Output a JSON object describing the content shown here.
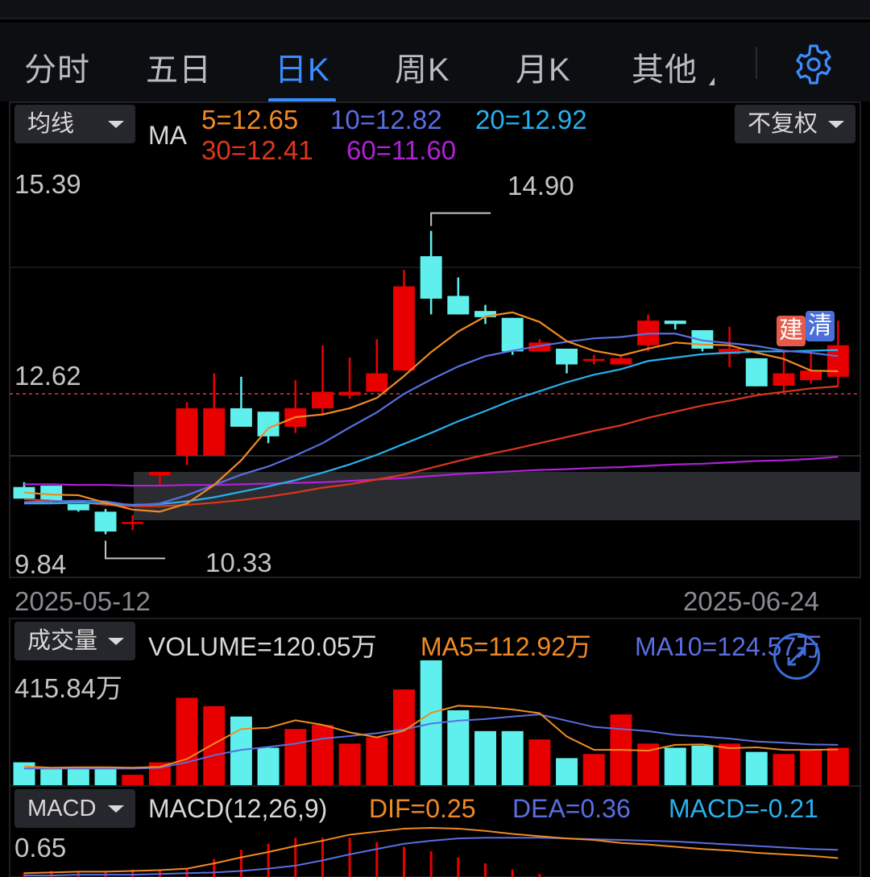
{
  "tabs": [
    {
      "label": "分时",
      "active": false
    },
    {
      "label": "五日",
      "active": false
    },
    {
      "label": "日K",
      "active": true
    },
    {
      "label": "周K",
      "active": false
    },
    {
      "label": "月K",
      "active": false
    },
    {
      "label": "其他",
      "active": false
    }
  ],
  "settings_icon": "gear-icon",
  "main_chart": {
    "indicator_dropdown": "均线",
    "indicator_name": "MA",
    "ma_values": {
      "ma5": "5=12.65",
      "ma10": "10=12.82",
      "ma20": "20=12.92",
      "ma30": "30=12.41",
      "ma60": "60=11.60"
    },
    "adjust_dropdown": "不复权",
    "y_top": "15.39",
    "y_mid": "12.62",
    "y_bottom": "9.84",
    "high_label": "14.90",
    "low_label": "10.33",
    "date_start": "2025-05-12",
    "date_end": "2025-06-24",
    "badge_build": "建",
    "badge_clear": "清"
  },
  "volume_chart": {
    "dropdown": "成交量",
    "volume": "VOLUME=120.05万",
    "ma5": "MA5=112.92万",
    "ma10": "MA10=124.57万",
    "max_label": "415.84万"
  },
  "macd_chart": {
    "dropdown": "MACD",
    "params": "MACD(12,26,9)",
    "dif": "DIF=0.25",
    "dea": "DEA=0.36",
    "macd": "MACD=-0.21",
    "max_label": "0.65"
  },
  "colors": {
    "up": "#e80000",
    "down": "#5ff0ee",
    "ma5": "#f08a24",
    "ma10": "#5a6ee0",
    "ma20": "#27b0ee",
    "ma30": "#e0351e",
    "ma60": "#b021d8",
    "accent": "#3a8dff"
  },
  "chart_data": {
    "type": "candlestick",
    "y_axis_range": [
      9.84,
      15.39
    ],
    "period": [
      "2025-05-12",
      "2025-06-24"
    ],
    "candles": [
      {
        "o": 10.96,
        "c": 10.79,
        "h": 11.03,
        "l": 10.79
      },
      {
        "o": 10.98,
        "c": 10.74,
        "h": 10.98,
        "l": 10.71
      },
      {
        "o": 10.71,
        "c": 10.62,
        "h": 10.71,
        "l": 10.6
      },
      {
        "o": 10.6,
        "c": 10.31,
        "h": 10.64,
        "l": 10.27
      },
      {
        "o": 10.43,
        "c": 10.45,
        "h": 10.55,
        "l": 10.33
      },
      {
        "o": 11.13,
        "c": 11.18,
        "h": 11.18,
        "l": 10.99
      },
      {
        "o": 11.42,
        "c": 12.11,
        "h": 12.2,
        "l": 11.28
      },
      {
        "o": 11.42,
        "c": 12.11,
        "h": 12.62,
        "l": 11.42
      },
      {
        "o": 12.11,
        "c": 11.84,
        "h": 12.57,
        "l": 11.84
      },
      {
        "o": 12.06,
        "c": 11.7,
        "h": 12.06,
        "l": 11.6
      },
      {
        "o": 11.84,
        "c": 12.11,
        "h": 12.52,
        "l": 11.75
      },
      {
        "o": 12.11,
        "c": 12.35,
        "h": 13.03,
        "l": 12.02
      },
      {
        "o": 12.3,
        "c": 12.35,
        "h": 12.85,
        "l": 12.25
      },
      {
        "o": 12.35,
        "c": 12.62,
        "h": 13.12,
        "l": 12.35
      },
      {
        "o": 12.66,
        "c": 13.89,
        "h": 14.13,
        "l": 12.66
      },
      {
        "o": 14.33,
        "c": 13.71,
        "h": 14.7,
        "l": 13.48
      },
      {
        "o": 13.75,
        "c": 13.48,
        "h": 14.02,
        "l": 13.48
      },
      {
        "o": 13.53,
        "c": 13.44,
        "h": 13.62,
        "l": 13.34
      },
      {
        "o": 13.43,
        "c": 12.94,
        "h": 13.43,
        "l": 12.89
      },
      {
        "o": 12.94,
        "c": 13.07,
        "h": 13.12,
        "l": 12.98
      },
      {
        "o": 12.98,
        "c": 12.75,
        "h": 12.98,
        "l": 12.62
      },
      {
        "o": 12.83,
        "c": 12.83,
        "h": 12.89,
        "l": 12.75
      },
      {
        "o": 12.75,
        "c": 12.84,
        "h": 12.89,
        "l": 12.75
      },
      {
        "o": 13.03,
        "c": 13.39,
        "h": 13.48,
        "l": 12.94
      },
      {
        "o": 13.39,
        "c": 13.34,
        "h": 13.39,
        "l": 13.26
      },
      {
        "o": 13.25,
        "c": 12.98,
        "h": 13.25,
        "l": 12.94
      },
      {
        "o": 12.9,
        "c": 12.98,
        "h": 13.3,
        "l": 12.71
      },
      {
        "o": 12.84,
        "c": 12.43,
        "h": 12.84,
        "l": 12.43
      },
      {
        "o": 12.44,
        "c": 12.62,
        "h": 12.94,
        "l": 12.34
      },
      {
        "o": 12.52,
        "c": 12.66,
        "h": 12.94,
        "l": 12.47
      },
      {
        "o": 12.57,
        "c": 13.03,
        "h": 13.39,
        "l": 12.43
      }
    ],
    "ma5": [
      10.88,
      10.85,
      10.84,
      10.73,
      10.63,
      10.6,
      10.72,
      10.99,
      11.35,
      11.82,
      11.98,
      12.02,
      12.11,
      12.26,
      12.58,
      12.93,
      13.23,
      13.45,
      13.51,
      13.37,
      13.09,
      12.95,
      12.88,
      12.98,
      13.07,
      13.04,
      13.03,
      12.92,
      12.83,
      12.66,
      12.65
    ],
    "ma10": [
      10.74,
      10.75,
      10.76,
      10.75,
      10.69,
      10.72,
      10.84,
      10.99,
      11.14,
      11.26,
      11.42,
      11.6,
      11.83,
      12.05,
      12.32,
      12.53,
      12.72,
      12.87,
      12.95,
      13.02,
      13.08,
      13.13,
      13.15,
      13.2,
      13.2,
      13.1,
      13.06,
      13.02,
      12.95,
      12.92,
      12.87
    ],
    "ma20": [
      10.72,
      10.72,
      10.73,
      10.72,
      10.7,
      10.71,
      10.75,
      10.81,
      10.89,
      10.97,
      11.06,
      11.17,
      11.29,
      11.43,
      11.59,
      11.75,
      11.92,
      12.07,
      12.23,
      12.36,
      12.49,
      12.6,
      12.68,
      12.8,
      12.85,
      12.9,
      12.92,
      12.94,
      12.94,
      12.95,
      12.96
    ],
    "ma30": [
      10.78,
      10.76,
      10.74,
      10.7,
      10.68,
      10.68,
      10.7,
      10.73,
      10.77,
      10.82,
      10.88,
      10.95,
      11.0,
      11.07,
      11.14,
      11.24,
      11.34,
      11.43,
      11.51,
      11.6,
      11.69,
      11.78,
      11.86,
      11.97,
      12.06,
      12.15,
      12.22,
      12.3,
      12.35,
      12.4,
      12.43
    ],
    "ma60": [
      11.0,
      11.0,
      10.99,
      10.99,
      10.98,
      10.98,
      10.99,
      10.99,
      11.0,
      11.01,
      11.02,
      11.03,
      11.05,
      11.07,
      11.09,
      11.12,
      11.15,
      11.17,
      11.19,
      11.21,
      11.22,
      11.24,
      11.25,
      11.27,
      11.29,
      11.3,
      11.32,
      11.34,
      11.35,
      11.37,
      11.4
    ],
    "volume": [
      55,
      40,
      40,
      40,
      25,
      55,
      210,
      190,
      165,
      90,
      135,
      145,
      100,
      115,
      230,
      300,
      180,
      130,
      130,
      110,
      65,
      75,
      170,
      100,
      90,
      95,
      100,
      80,
      75,
      85,
      90
    ],
    "volume_ma5": [
      45,
      42,
      43,
      43,
      42,
      44,
      63,
      100,
      135,
      138,
      156,
      145,
      127,
      115,
      131,
      174,
      191,
      188,
      182,
      173,
      117,
      85,
      85,
      83,
      97,
      98,
      89,
      91,
      85,
      85,
      86
    ],
    "volume_ma10": [
      40,
      40,
      40,
      40,
      40,
      42,
      55,
      72,
      85,
      92,
      100,
      112,
      118,
      125,
      134,
      148,
      155,
      159,
      165,
      170,
      155,
      140,
      135,
      130,
      121,
      117,
      112,
      105,
      102,
      98,
      97
    ],
    "macd_dif": [
      0.05,
      0.06,
      0.07,
      0.07,
      0.08,
      0.09,
      0.11,
      0.18,
      0.26,
      0.33,
      0.41,
      0.48,
      0.56,
      0.6,
      0.64,
      0.65,
      0.64,
      0.61,
      0.57,
      0.54,
      0.51,
      0.49,
      0.45,
      0.43,
      0.4,
      0.37,
      0.35,
      0.32,
      0.3,
      0.28,
      0.25
    ],
    "macd_dea": [
      0.02,
      0.02,
      0.03,
      0.03,
      0.03,
      0.04,
      0.05,
      0.06,
      0.08,
      0.11,
      0.15,
      0.22,
      0.3,
      0.37,
      0.44,
      0.48,
      0.51,
      0.52,
      0.52,
      0.52,
      0.51,
      0.5,
      0.49,
      0.48,
      0.47,
      0.45,
      0.43,
      0.41,
      0.39,
      0.37,
      0.36
    ]
  }
}
